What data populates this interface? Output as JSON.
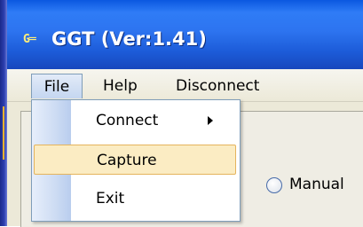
{
  "window": {
    "title": "GGT (Ver:1.41)",
    "icon_text": "G═"
  },
  "menubar": {
    "file": "File",
    "help": "Help",
    "disconnect": "Disconnect"
  },
  "file_menu": {
    "items": [
      {
        "label": "Connect",
        "has_submenu": true
      },
      {
        "label": "Capture",
        "highlighted": true
      },
      {
        "label": "Exit"
      }
    ]
  },
  "content": {
    "radio_label": "Manual"
  },
  "colors": {
    "titlebar": "#2d74f0",
    "menu_highlight": "#fbecc3",
    "menu_highlight_border": "#e5b45c"
  }
}
